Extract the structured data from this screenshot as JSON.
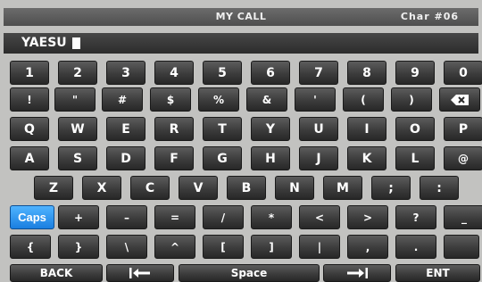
{
  "header": {
    "title": "MY CALL",
    "char_counter": "Char #06"
  },
  "input": {
    "value": "YAESU"
  },
  "keyboard": {
    "rows": [
      [
        "1",
        "2",
        "3",
        "4",
        "5",
        "6",
        "7",
        "8",
        "9",
        "0"
      ],
      [
        "!",
        "\"",
        "#",
        "$",
        "%",
        "&",
        "'",
        "(",
        ")"
      ],
      [
        "Q",
        "W",
        "E",
        "R",
        "T",
        "Y",
        "U",
        "I",
        "O",
        "P"
      ],
      [
        "A",
        "S",
        "D",
        "F",
        "G",
        "H",
        "J",
        "K",
        "L",
        "@"
      ],
      [
        "Z",
        "X",
        "C",
        "V",
        "B",
        "N",
        "M",
        ";",
        ":"
      ],
      [
        "+",
        "–",
        "=",
        "/",
        "*",
        "<",
        ">",
        "?",
        "_"
      ],
      [
        "{",
        "}",
        "\\",
        "^",
        "[",
        "]",
        "|",
        ",",
        "."
      ]
    ],
    "caps_label": "Caps",
    "back_label": "BACK",
    "space_label": "Space",
    "enter_label": "ENT"
  },
  "colors": {
    "caps_active": "#2a95f3",
    "key_face": "#3c3c3c",
    "panel": "#c2c2c0"
  }
}
